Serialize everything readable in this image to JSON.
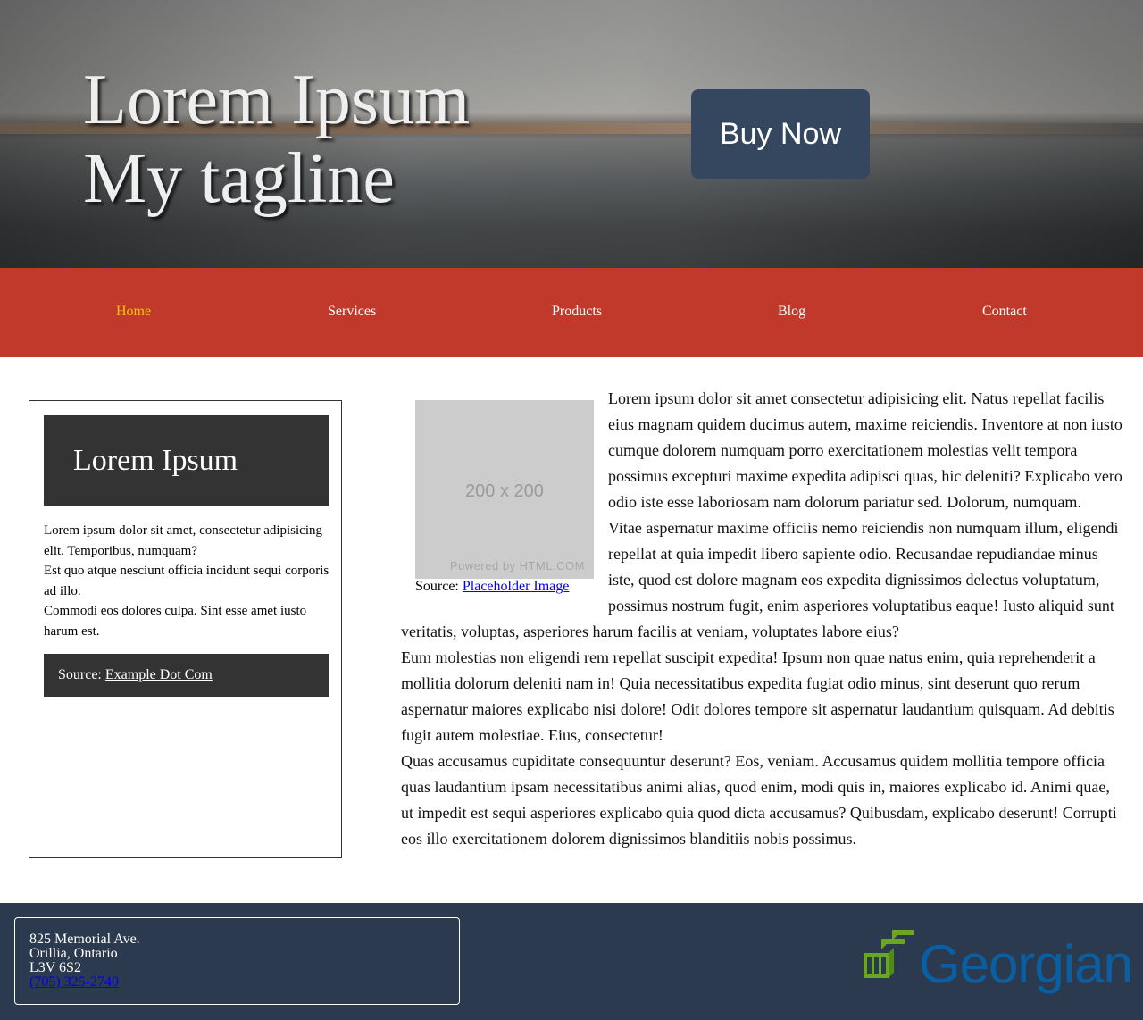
{
  "hero": {
    "title_line1": "Lorem Ipsum",
    "title_line2": "My tagline",
    "buy_button": "Buy Now"
  },
  "nav": {
    "items": [
      {
        "label": "Home",
        "active": true
      },
      {
        "label": "Services",
        "active": false
      },
      {
        "label": "Products",
        "active": false
      },
      {
        "label": "Blog",
        "active": false
      },
      {
        "label": "Contact",
        "active": false
      }
    ],
    "active_color": "#f3c316",
    "background": "#c0392b"
  },
  "card": {
    "title": "Lorem Ipsum",
    "paragraphs": [
      "Lorem ipsum dolor sit amet, consectetur adipisicing elit. Temporibus, numquam?",
      "Est quo atque nesciunt officia incidunt sequi corporis ad illo.",
      "Commodi eos dolores culpa. Sint esse amet iusto harum est."
    ],
    "source_label": "Source:",
    "source_link": "Example Dot Com"
  },
  "article": {
    "placeholder_dims": "200 x 200",
    "placeholder_powered": "Powered by HTML.COM",
    "caption_label": "Source:",
    "caption_link": "Placeholder Image",
    "paragraphs": [
      "Lorem ipsum dolor sit amet consectetur adipisicing elit. Natus repellat facilis eius magnam quidem ducimus autem, maxime reiciendis. Inventore at non iusto cumque dolorem numquam porro exercitationem molestias velit tempora possimus excepturi maxime expedita adipisci quas, hic deleniti? Explicabo vero odio iste esse laboriosam nam dolorum pariatur sed. Dolorum, numquam.",
      "Vitae aspernatur maxime officiis nemo reiciendis non numquam illum, eligendi repellat at quia impedit libero sapiente odio. Recusandae repudiandae minus iste, quod est dolore magnam eos expedita dignissimos delectus voluptatum, possimus nostrum fugit, enim asperiores voluptatibus eaque! Iusto aliquid sunt veritatis, voluptas, asperiores harum facilis at veniam, voluptates labore eius?",
      "Eum molestias non eligendi rem repellat suscipit expedita! Ipsum non quae natus enim, quia reprehenderit a mollitia dolorum deleniti nam in! Quia necessitatibus expedita fugiat odio minus, sint deserunt quo rerum aspernatur maiores explicabo nisi dolore! Odit dolores tempore sit aspernatur laudantium quisquam. Ad debitis fugit autem molestiae. Eius, consectetur!",
      "Quas accusamus cupiditate consequuntur deserunt? Eos, veniam. Accusamus quidem mollitia tempore officia quas laudantium ipsam necessitatibus animi alias, quod enim, modi quis in, maiores explicabo id. Animi quae, ut impedit est sequi asperiores explicabo quia quod dicta accusamus? Quibusdam, explicabo deserunt! Corrupti eos illo exercitationem dolorem dignissimos blanditiis nobis possimus."
    ]
  },
  "footer": {
    "address_line1": "825 Memorial Ave.",
    "address_line2": "Orillia, Ontario",
    "address_line3": "L3V 6S2",
    "phone": "(705) 325-2740",
    "logo_text": "Georgian",
    "logo_color": "#0a5fa3",
    "logo_mark_color": "#6aa621",
    "background": "#2b3a4e"
  }
}
